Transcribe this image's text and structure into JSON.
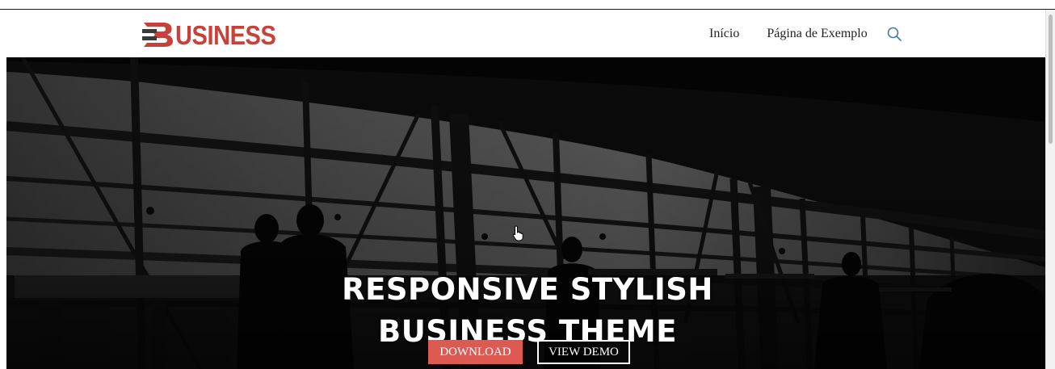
{
  "brand": {
    "logo_text": "USINESS",
    "logo_color": "#c9403a"
  },
  "nav": {
    "items": [
      {
        "label": "Início"
      },
      {
        "label": "Página de Exemplo"
      }
    ],
    "search_icon": "search-icon",
    "search_color": "#4a7aa8"
  },
  "hero": {
    "title_line1": "RESPONSIVE STYLISH",
    "title_line2": "BUSINESS THEME",
    "download_label": "DOWNLOAD",
    "view_demo_label": "VIEW DEMO",
    "accent": "#dd5a52"
  }
}
